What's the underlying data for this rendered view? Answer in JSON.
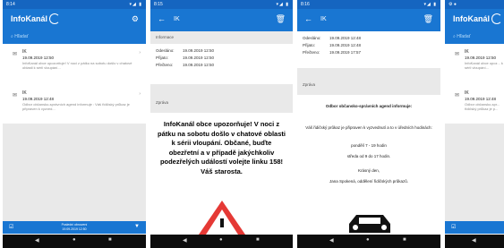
{
  "app": {
    "name": "InfoKanál",
    "search_placeholder": "Hľadať"
  },
  "screens": [
    {
      "time": "8:14",
      "status_icons": "▾◢ ▮"
    },
    {
      "time": "8:15",
      "status_icons": "▾◢ ▮"
    },
    {
      "time": "8:16",
      "status_icons": "▾◢ ▮"
    },
    {
      "time": "",
      "status_icons": ""
    }
  ],
  "list_items": [
    {
      "title": "IK",
      "date": "19.09.2019 12:50",
      "snippet": "InfoKanál obce upozorňuje! V noci z pátku na sobotu došlo v chatové oblasti k sérii vloupání..."
    },
    {
      "title": "IK",
      "date": "19.09.2019 12:48",
      "snippet": "Odbor občansko-správních agend  informuje : Váš řidičský průkaz je připraven k vyzved..."
    }
  ],
  "list_items_p4": [
    {
      "title": "IK",
      "date": "19.09.2019 12:50",
      "snippet": "InfoKanál obce upoz... k sérii vloupání..."
    },
    {
      "title": "IK",
      "date": "19.09.2019 12:48",
      "snippet": "Odbor občansko-spr... řidičský průkaz je p..."
    }
  ],
  "bottom_bar": {
    "line1": "Posledni obnovení",
    "line2": "19.09.2019 12:50"
  },
  "detail": {
    "header": "IK",
    "section_info": "Informace",
    "section_msg": "Zpráva",
    "rows": [
      {
        "k": "Odesláno:",
        "v": "19.09.2019 12:50"
      },
      {
        "k": "Přijato:",
        "v": "19.09.2019 12:50"
      },
      {
        "k": "Přečteno:",
        "v": "19.09.2019 12:50"
      }
    ],
    "message": "InfoKanál obce upozorňuje! V noci z pátku na sobotu došlo v chatové oblasti k sérii vloupání. Občané, buďte obezřetní a v případě jakýchkoliv podezřelých událostí volejte linku 158! Váš starosta."
  },
  "detail2": {
    "rows": [
      {
        "k": "Odesláno:",
        "v": "19.09.2019 12:48"
      },
      {
        "k": "Přijato:",
        "v": "19.09.2019 12:48"
      },
      {
        "k": "Přečteno:",
        "v": "19.09.2019 17:57"
      }
    ],
    "heading": "Odbor občansko-správních agend  informuje:",
    "body": "Váš řidičský průkaz je připraven k vyzvednutí a to v úředních hodinách:",
    "hours1": "pondělí  7 - 19 hodin",
    "hours2": "středa od 9 do 17 hodin.",
    "greeting": "Krásný den,",
    "signature": "Jana Spokená, oddělení řidičských průkazů."
  }
}
